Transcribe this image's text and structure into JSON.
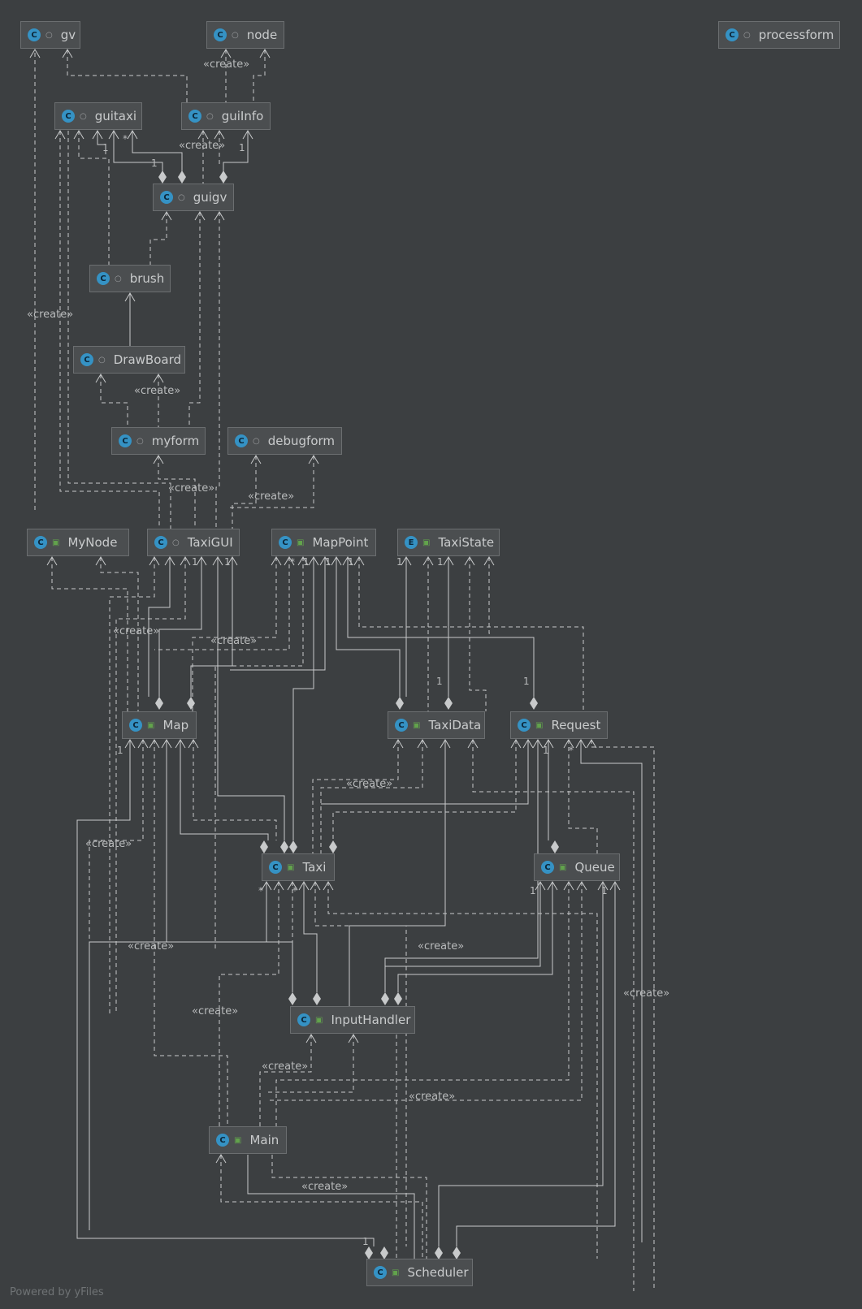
{
  "nodes": [
    {
      "id": "gv",
      "label": "gv",
      "kind": "C",
      "access": "pkg"
    },
    {
      "id": "node",
      "label": "node",
      "kind": "C",
      "access": "pkg"
    },
    {
      "id": "processform",
      "label": "processform",
      "kind": "C",
      "access": "pkg"
    },
    {
      "id": "guitaxi",
      "label": "guitaxi",
      "kind": "C",
      "access": "pkg"
    },
    {
      "id": "guiInfo",
      "label": "guiInfo",
      "kind": "C",
      "access": "pkg"
    },
    {
      "id": "guigv",
      "label": "guigv",
      "kind": "C",
      "access": "pkg"
    },
    {
      "id": "brush",
      "label": "brush",
      "kind": "C",
      "access": "pkg"
    },
    {
      "id": "DrawBoard",
      "label": "DrawBoard",
      "kind": "C",
      "access": "pkg"
    },
    {
      "id": "myform",
      "label": "myform",
      "kind": "C",
      "access": "pkg"
    },
    {
      "id": "debugform",
      "label": "debugform",
      "kind": "C",
      "access": "pkg"
    },
    {
      "id": "MyNode",
      "label": "MyNode",
      "kind": "C",
      "access": "public"
    },
    {
      "id": "TaxiGUI",
      "label": "TaxiGUI",
      "kind": "C",
      "access": "pkg"
    },
    {
      "id": "MapPoint",
      "label": "MapPoint",
      "kind": "C",
      "access": "public"
    },
    {
      "id": "TaxiState",
      "label": "TaxiState",
      "kind": "E",
      "access": "public"
    },
    {
      "id": "Map",
      "label": "Map",
      "kind": "C",
      "access": "public"
    },
    {
      "id": "TaxiData",
      "label": "TaxiData",
      "kind": "C",
      "access": "public"
    },
    {
      "id": "Request",
      "label": "Request",
      "kind": "C",
      "access": "public"
    },
    {
      "id": "Taxi",
      "label": "Taxi",
      "kind": "C",
      "access": "public"
    },
    {
      "id": "Queue",
      "label": "Queue",
      "kind": "C",
      "access": "public"
    },
    {
      "id": "InputHandler",
      "label": "InputHandler",
      "kind": "C",
      "access": "public"
    },
    {
      "id": "Main",
      "label": "Main",
      "kind": "C",
      "access": "public"
    },
    {
      "id": "Scheduler",
      "label": "Scheduler",
      "kind": "C",
      "access": "public"
    }
  ],
  "create_label": "«create»",
  "multiplicities": [
    "1",
    "*"
  ],
  "footer": "Powered by yFiles"
}
